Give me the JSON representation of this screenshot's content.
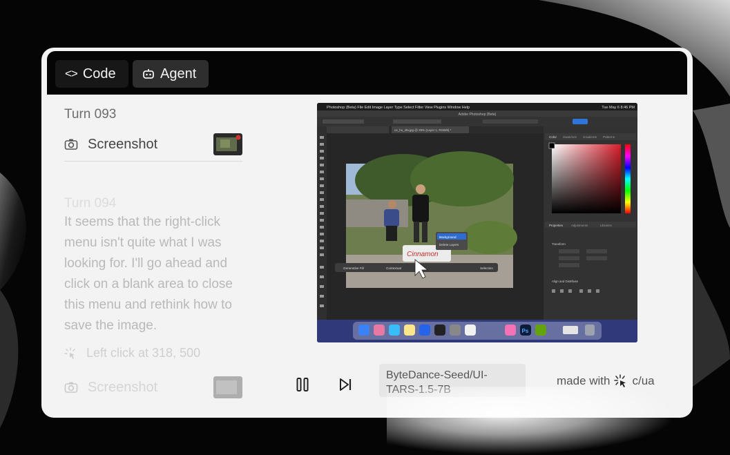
{
  "tabs": [
    {
      "label": "Code",
      "icon": "code-brackets-icon"
    },
    {
      "label": "Agent",
      "icon": "robot-icon"
    }
  ],
  "log": {
    "turn_a": "Turn 093",
    "screenshot_label_a": "Screenshot",
    "turn_b": "Turn 094",
    "thought": "It seems that the right-click menu isn't quite what I was looking for. I'll go ahead and click on a blank area to close this menu and rethink how to save the image.",
    "action": "Left click at 318, 500",
    "screenshot_label_b": "Screenshot"
  },
  "screen": {
    "menubar": [
      "Photoshop (Beta)",
      "File",
      "Edit",
      "Image",
      "Layer",
      "Type",
      "Select",
      "Filter",
      "View",
      "Plugins",
      "Window",
      "Help"
    ],
    "clock": "Tue May 6 8:46 PM",
    "doc_title": "Adobe Photoshop (Beta)",
    "doc_tab": "ce_hu_sfa.jpg @ 29% (Layer 1, RGB/8) *",
    "panel_tabs": [
      "Color",
      "Swatches",
      "Gradients",
      "Patterns"
    ],
    "props_tabs": [
      "Properties",
      "Adjustments",
      "Libraries"
    ],
    "section_transform": "Transform",
    "section_align": "Align and Distribute",
    "context_menu": [
      "Background",
      "Delete Layers"
    ],
    "taskbar_items": [
      "Generative Fill",
      "Contextual",
      "Selection"
    ],
    "dock_ps_label": "Ps",
    "photo_sign": "Cinnamon"
  },
  "controls": {
    "pause_icon": "pause-icon",
    "next_icon": "skip-next-icon",
    "model_name": "ByteDance-Seed/UI-TARS-1.5-7B",
    "made_with": "made with",
    "brand": "c/ua"
  },
  "colors": {
    "card_bg": "#f3f3f3",
    "topbar_bg": "#050505",
    "ps_gradient_red": "#d81e2b"
  }
}
